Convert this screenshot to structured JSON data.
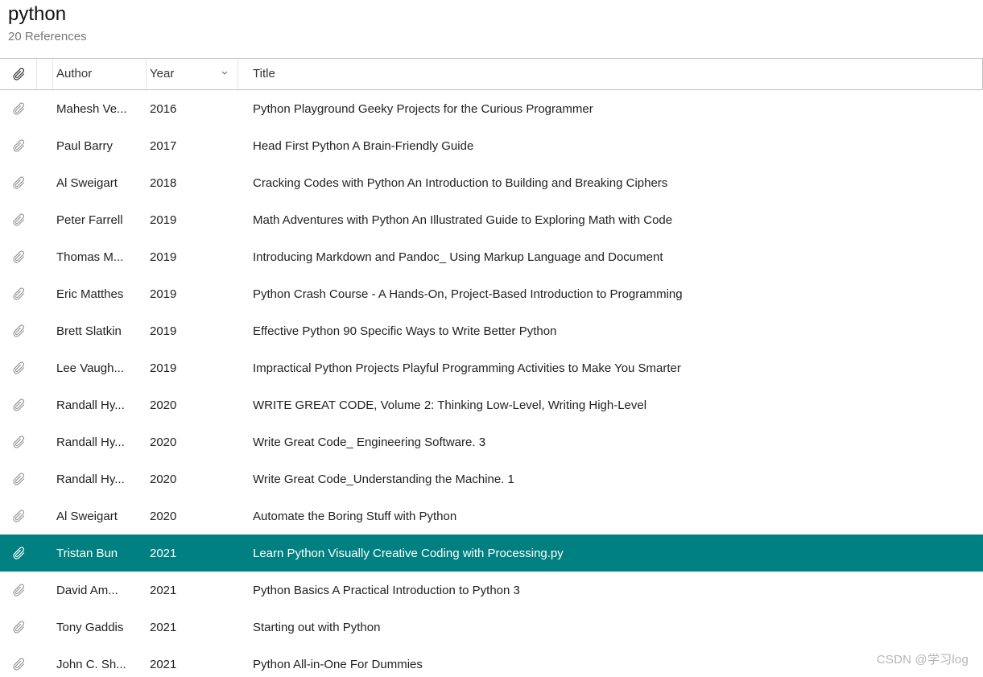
{
  "header": {
    "title": "python",
    "subtitle": "20 References"
  },
  "columns": {
    "author": "Author",
    "year": "Year",
    "title": "Title",
    "sorted_column": "year",
    "sort_direction": "desc"
  },
  "rows": [
    {
      "author": "Mahesh Ve...",
      "year": "2016",
      "title": "Python Playground Geeky Projects for the Curious Programmer",
      "selected": false
    },
    {
      "author": "Paul Barry",
      "year": "2017",
      "title": "Head First Python  A Brain-Friendly Guide",
      "selected": false
    },
    {
      "author": "Al Sweigart",
      "year": "2018",
      "title": "Cracking Codes with Python An Introduction to Building and Breaking Ciphers",
      "selected": false
    },
    {
      "author": "Peter Farrell",
      "year": "2019",
      "title": "Math Adventures with Python An Illustrated Guide to Exploring Math with Code",
      "selected": false
    },
    {
      "author": "Thomas M...",
      "year": "2019",
      "title": "Introducing Markdown and Pandoc_ Using Markup Language and Document",
      "selected": false
    },
    {
      "author": "Eric Matthes",
      "year": "2019",
      "title": "Python Crash Course - A Hands-On, Project-Based Introduction to Programming",
      "selected": false
    },
    {
      "author": "Brett Slatkin",
      "year": "2019",
      "title": "Effective Python 90 Specific Ways to Write Better Python",
      "selected": false
    },
    {
      "author": "Lee Vaugh...",
      "year": "2019",
      "title": "Impractical Python Projects Playful Programming Activities to Make You Smarter",
      "selected": false
    },
    {
      "author": "Randall Hy...",
      "year": "2020",
      "title": "WRITE GREAT CODE, Volume 2: Thinking Low-Level, Writing High-Level",
      "selected": false
    },
    {
      "author": "Randall Hy...",
      "year": "2020",
      "title": "Write Great Code_ Engineering Software. 3",
      "selected": false
    },
    {
      "author": "Randall Hy...",
      "year": "2020",
      "title": "Write Great Code_Understanding the Machine. 1",
      "selected": false
    },
    {
      "author": "Al Sweigart",
      "year": "2020",
      "title": "Automate the Boring Stuff with Python",
      "selected": false
    },
    {
      "author": "Tristan Bun",
      "year": "2021",
      "title": "Learn Python Visually Creative Coding with Processing.py",
      "selected": true
    },
    {
      "author": "David Am...",
      "year": "2021",
      "title": "Python Basics A Practical Introduction to Python 3",
      "selected": false
    },
    {
      "author": "Tony Gaddis",
      "year": "2021",
      "title": "Starting out with Python",
      "selected": false
    },
    {
      "author": "John C. Sh...",
      "year": "2021",
      "title": "Python All-in-One For Dummies",
      "selected": false
    }
  ],
  "watermark": "CSDN @学习log"
}
